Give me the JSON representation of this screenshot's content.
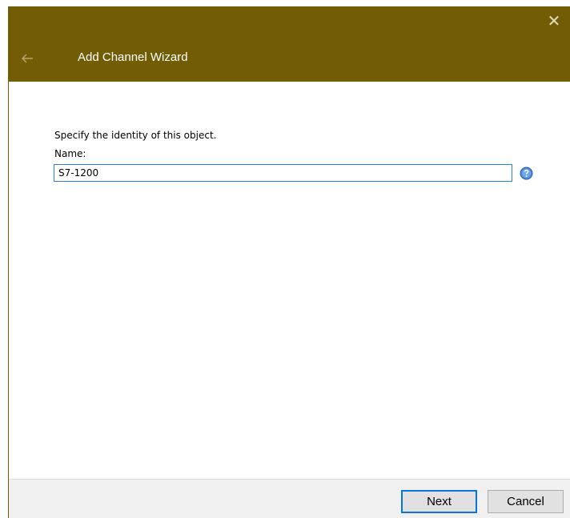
{
  "window": {
    "title": "Add Channel Wizard",
    "close_glyph": "✕",
    "back_icon": "back-arrow-icon",
    "accent_color": "#725d04"
  },
  "form": {
    "instruction": "Specify the identity of this object.",
    "name_label": "Name:",
    "name_value": "S7-1200",
    "help_icon": "help-icon"
  },
  "footer": {
    "next_label": "Next",
    "cancel_label": "Cancel"
  }
}
